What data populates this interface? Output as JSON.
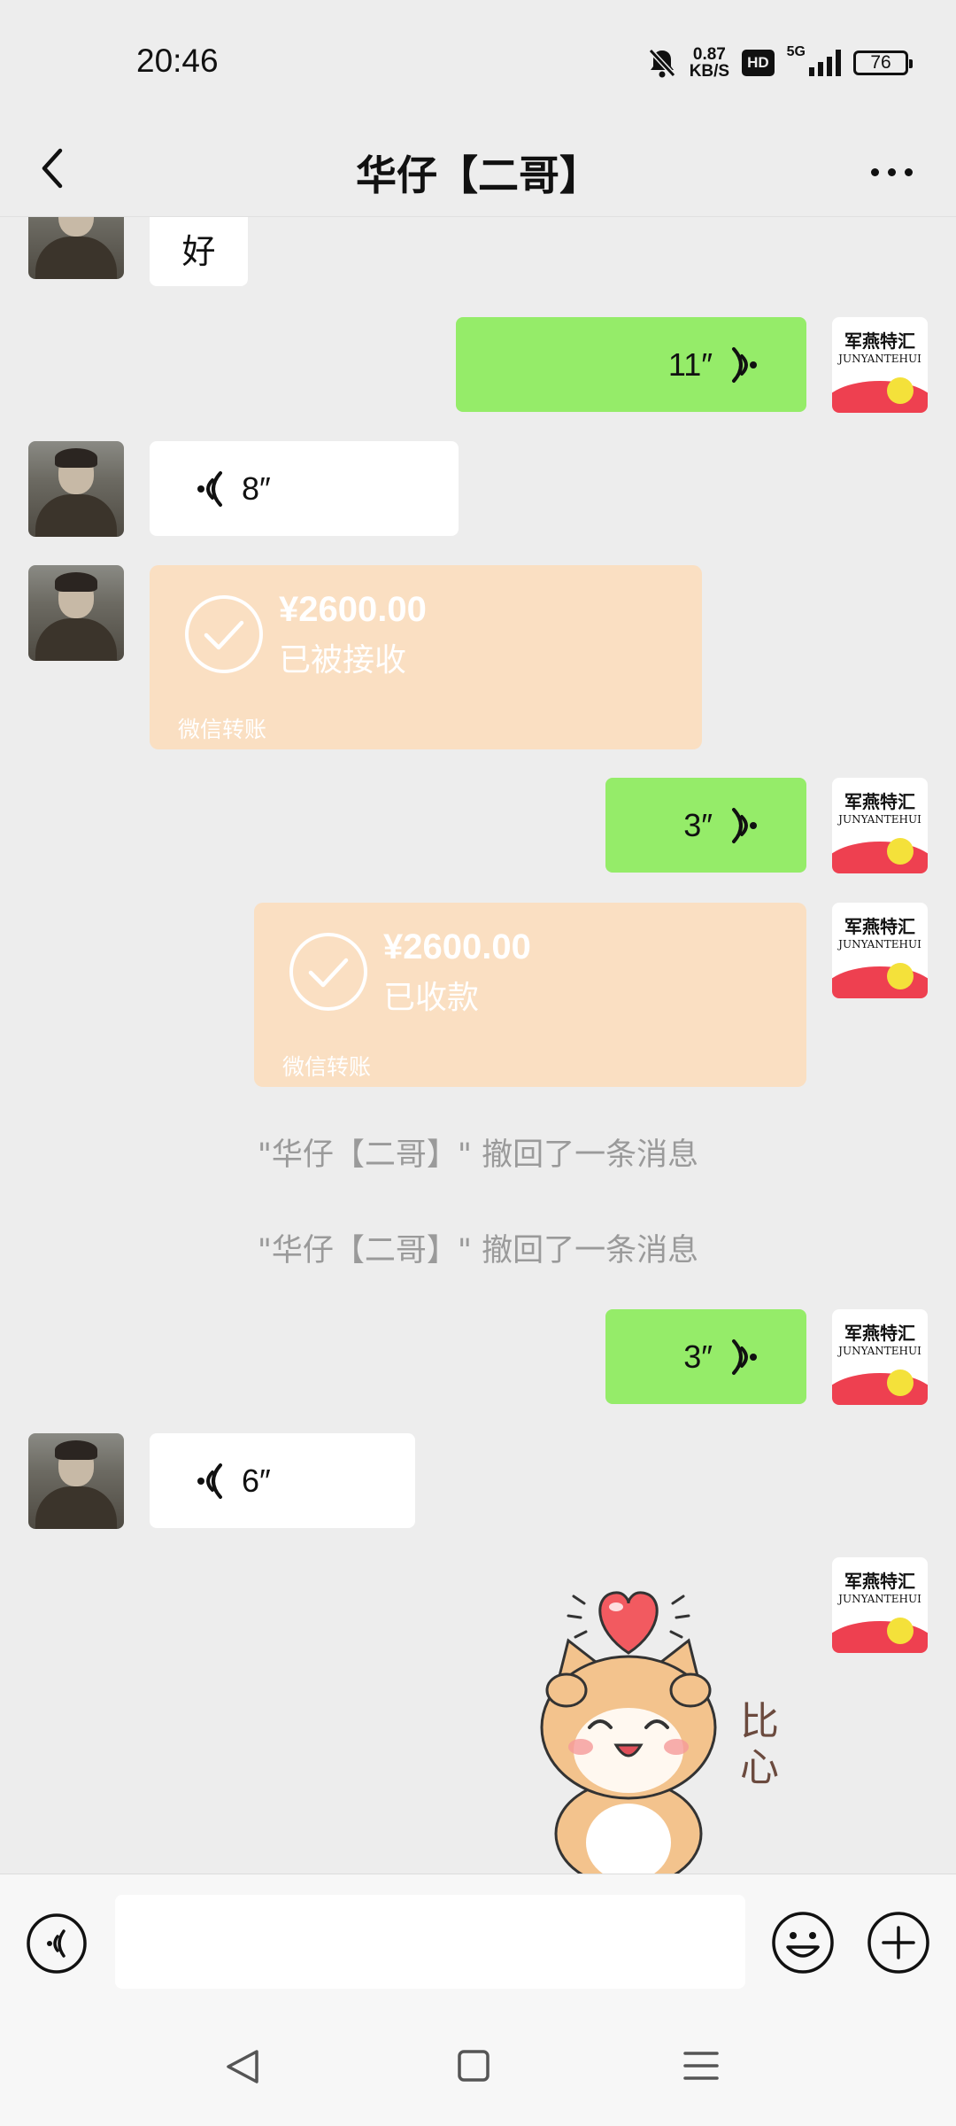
{
  "status_bar": {
    "time": "20:46",
    "net_speed_value": "0.87",
    "net_speed_unit": "KB/S",
    "hd": "HD",
    "network": "5G",
    "battery": "76"
  },
  "header": {
    "title": "华仔【二哥】"
  },
  "messages": {
    "text_hao": "好",
    "voice_sent_1": "11″",
    "voice_recv_1": "8″",
    "transfer_1": {
      "amount": "¥2600.00",
      "status": "已被接收",
      "label": "微信转账"
    },
    "voice_sent_2": "3″",
    "transfer_2": {
      "amount": "¥2600.00",
      "status": "已收款",
      "label": "微信转账"
    },
    "recall_1": "\"华仔【二哥】\" 撤回了一条消息",
    "recall_2": "\"华仔【二哥】\" 撤回了一条消息",
    "voice_sent_3": "3″",
    "voice_recv_2": "6″"
  },
  "sticker": {
    "text": "比心",
    "icon": "shiba-heart-sticker"
  },
  "self_avatar": {
    "line1": "军燕特汇",
    "line2": "JUNYANTEHUI"
  },
  "colors": {
    "background": "#ededed",
    "sent_bubble": "#95ec69",
    "received_bubble": "#ffffff",
    "transfer_card": "#fadfc2",
    "system_text": "#9a9a9a"
  }
}
